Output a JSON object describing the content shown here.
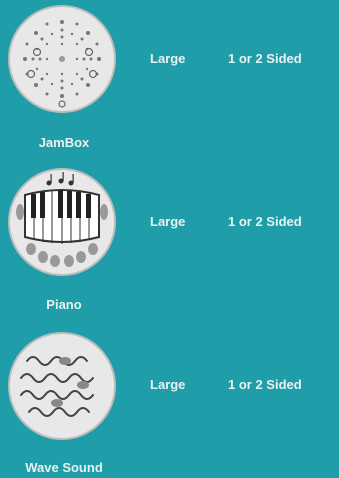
{
  "items": [
    {
      "name": "JamBox",
      "size": "Large",
      "sides": "1 or 2 Sided"
    },
    {
      "name": "Piano",
      "size": "Large",
      "sides": "1 or 2 Sided"
    },
    {
      "name": "Wave Sound",
      "size": "Large",
      "sides": "1 or 2 Sided"
    }
  ],
  "colors": {
    "background": "#1f9da8",
    "text": "#e9f2f2",
    "disc": "#e7e7e7"
  }
}
